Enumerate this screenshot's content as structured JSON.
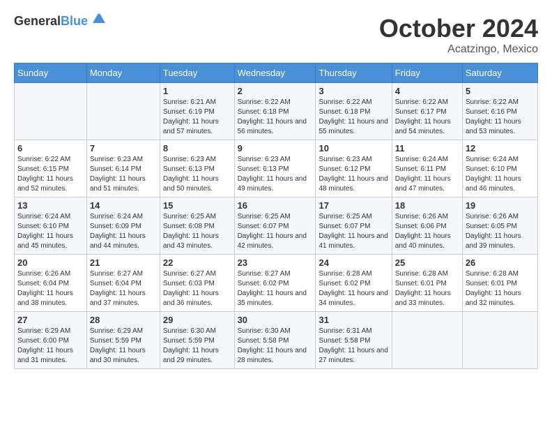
{
  "header": {
    "logo_general": "General",
    "logo_blue": "Blue",
    "month_title": "October 2024",
    "location": "Acatzingo, Mexico"
  },
  "days_of_week": [
    "Sunday",
    "Monday",
    "Tuesday",
    "Wednesday",
    "Thursday",
    "Friday",
    "Saturday"
  ],
  "weeks": [
    [
      {
        "day": null,
        "info": null
      },
      {
        "day": null,
        "info": null
      },
      {
        "day": "1",
        "info": "Sunrise: 6:21 AM\nSunset: 6:19 PM\nDaylight: 11 hours and 57 minutes."
      },
      {
        "day": "2",
        "info": "Sunrise: 6:22 AM\nSunset: 6:18 PM\nDaylight: 11 hours and 56 minutes."
      },
      {
        "day": "3",
        "info": "Sunrise: 6:22 AM\nSunset: 6:18 PM\nDaylight: 11 hours and 55 minutes."
      },
      {
        "day": "4",
        "info": "Sunrise: 6:22 AM\nSunset: 6:17 PM\nDaylight: 11 hours and 54 minutes."
      },
      {
        "day": "5",
        "info": "Sunrise: 6:22 AM\nSunset: 6:16 PM\nDaylight: 11 hours and 53 minutes."
      }
    ],
    [
      {
        "day": "6",
        "info": "Sunrise: 6:22 AM\nSunset: 6:15 PM\nDaylight: 11 hours and 52 minutes."
      },
      {
        "day": "7",
        "info": "Sunrise: 6:23 AM\nSunset: 6:14 PM\nDaylight: 11 hours and 51 minutes."
      },
      {
        "day": "8",
        "info": "Sunrise: 6:23 AM\nSunset: 6:13 PM\nDaylight: 11 hours and 50 minutes."
      },
      {
        "day": "9",
        "info": "Sunrise: 6:23 AM\nSunset: 6:13 PM\nDaylight: 11 hours and 49 minutes."
      },
      {
        "day": "10",
        "info": "Sunrise: 6:23 AM\nSunset: 6:12 PM\nDaylight: 11 hours and 48 minutes."
      },
      {
        "day": "11",
        "info": "Sunrise: 6:24 AM\nSunset: 6:11 PM\nDaylight: 11 hours and 47 minutes."
      },
      {
        "day": "12",
        "info": "Sunrise: 6:24 AM\nSunset: 6:10 PM\nDaylight: 11 hours and 46 minutes."
      }
    ],
    [
      {
        "day": "13",
        "info": "Sunrise: 6:24 AM\nSunset: 6:10 PM\nDaylight: 11 hours and 45 minutes."
      },
      {
        "day": "14",
        "info": "Sunrise: 6:24 AM\nSunset: 6:09 PM\nDaylight: 11 hours and 44 minutes."
      },
      {
        "day": "15",
        "info": "Sunrise: 6:25 AM\nSunset: 6:08 PM\nDaylight: 11 hours and 43 minutes."
      },
      {
        "day": "16",
        "info": "Sunrise: 6:25 AM\nSunset: 6:07 PM\nDaylight: 11 hours and 42 minutes."
      },
      {
        "day": "17",
        "info": "Sunrise: 6:25 AM\nSunset: 6:07 PM\nDaylight: 11 hours and 41 minutes."
      },
      {
        "day": "18",
        "info": "Sunrise: 6:26 AM\nSunset: 6:06 PM\nDaylight: 11 hours and 40 minutes."
      },
      {
        "day": "19",
        "info": "Sunrise: 6:26 AM\nSunset: 6:05 PM\nDaylight: 11 hours and 39 minutes."
      }
    ],
    [
      {
        "day": "20",
        "info": "Sunrise: 6:26 AM\nSunset: 6:04 PM\nDaylight: 11 hours and 38 minutes."
      },
      {
        "day": "21",
        "info": "Sunrise: 6:27 AM\nSunset: 6:04 PM\nDaylight: 11 hours and 37 minutes."
      },
      {
        "day": "22",
        "info": "Sunrise: 6:27 AM\nSunset: 6:03 PM\nDaylight: 11 hours and 36 minutes."
      },
      {
        "day": "23",
        "info": "Sunrise: 6:27 AM\nSunset: 6:02 PM\nDaylight: 11 hours and 35 minutes."
      },
      {
        "day": "24",
        "info": "Sunrise: 6:28 AM\nSunset: 6:02 PM\nDaylight: 11 hours and 34 minutes."
      },
      {
        "day": "25",
        "info": "Sunrise: 6:28 AM\nSunset: 6:01 PM\nDaylight: 11 hours and 33 minutes."
      },
      {
        "day": "26",
        "info": "Sunrise: 6:28 AM\nSunset: 6:01 PM\nDaylight: 11 hours and 32 minutes."
      }
    ],
    [
      {
        "day": "27",
        "info": "Sunrise: 6:29 AM\nSunset: 6:00 PM\nDaylight: 11 hours and 31 minutes."
      },
      {
        "day": "28",
        "info": "Sunrise: 6:29 AM\nSunset: 5:59 PM\nDaylight: 11 hours and 30 minutes."
      },
      {
        "day": "29",
        "info": "Sunrise: 6:30 AM\nSunset: 5:59 PM\nDaylight: 11 hours and 29 minutes."
      },
      {
        "day": "30",
        "info": "Sunrise: 6:30 AM\nSunset: 5:58 PM\nDaylight: 11 hours and 28 minutes."
      },
      {
        "day": "31",
        "info": "Sunrise: 6:31 AM\nSunset: 5:58 PM\nDaylight: 11 hours and 27 minutes."
      },
      {
        "day": null,
        "info": null
      },
      {
        "day": null,
        "info": null
      }
    ]
  ]
}
